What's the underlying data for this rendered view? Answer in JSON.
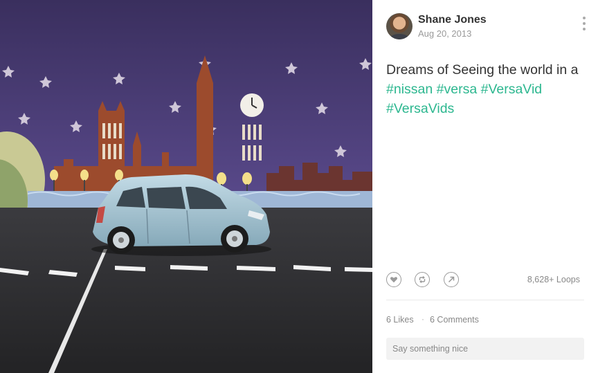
{
  "post": {
    "author": {
      "name": "Shane Jones",
      "date": "Aug 20, 2013"
    },
    "caption": {
      "text": "Dreams of Seeing the world in a",
      "hashtags": [
        "#nissan",
        "#versa",
        "#VersaVid",
        "#VersaVids"
      ]
    },
    "stats": {
      "loops": "8,628+ Loops",
      "likes": "6 Likes",
      "separator": "·",
      "comments": "6 Comments"
    },
    "comment_input": {
      "placeholder": "Say something nice"
    }
  },
  "icons": {
    "more": "more-vertical-icon",
    "like": "heart-icon",
    "revine": "revine-icon",
    "share": "share-arrow-icon"
  },
  "colors": {
    "hashtag": "#2cb78f",
    "scene_sky": "#4b3a75",
    "scene_building": "#9c4b2d",
    "car_body": "#a9c8d6"
  }
}
